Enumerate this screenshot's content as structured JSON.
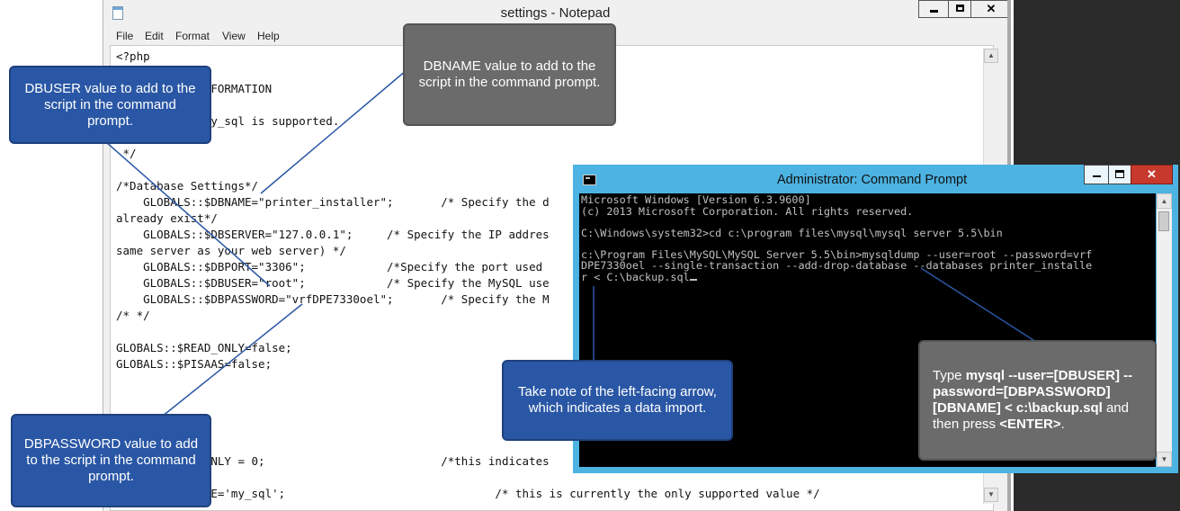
{
  "notepad": {
    "title": "settings - Notepad",
    "menu": [
      "File",
      "Edit",
      "Format",
      "View",
      "Help"
    ],
    "code_lines": [
      "<?php",
      "",
      "        ION INFORMATION",
      "",
      "        only my_sql is supported.",
      "",
      " */",
      "",
      "/*Database Settings*/",
      "    GLOBALS::$DBNAME=\"printer_installer\";       /* Specify the d",
      "already exist*/",
      "    GLOBALS::$DBSERVER=\"127.0.0.1\";     /* Specify the IP addres",
      "same server as your web server) */",
      "    GLOBALS::$DBPORT=\"3306\";            /*Specify the port used",
      "    GLOBALS::$DBUSER=\"root\";            /* Specify the MySQL use",
      "    GLOBALS::$DBPASSWORD=\"vrfDPE7330oel\";       /* Specify the M",
      "/* */",
      "",
      "GLOBALS::$READ_ONLY=false;",
      "GLOBALS::$PISAAS=false;",
      "",
      "",
      "",
      "",
      "",
      "            CONLY = 0;                          /*this indicates",
      "",
      "            YPE='my_sql';                               /* this is currently the only supported value */"
    ]
  },
  "cmd": {
    "title": "Administrator: Command Prompt",
    "lines": [
      "Microsoft Windows [Version 6.3.9600]",
      "(c) 2013 Microsoft Corporation. All rights reserved.",
      "",
      "C:\\Windows\\system32>cd c:\\program files\\mysql\\mysql server 5.5\\bin",
      "",
      "c:\\Program Files\\MySQL\\MySQL Server 5.5\\bin>mysqldump --user=root --password=vrf",
      "DPE7330oel --single-transaction --add-drop-database --databases printer_installe",
      "r < C:\\backup.sql"
    ]
  },
  "callouts": {
    "dbuser": "DBUSER value to add to the script in the command prompt.",
    "dbname": "DBNAME value to add to the script in the command prompt.",
    "dbpassword": "DBPASSWORD value to add to the script in the command prompt.",
    "arrow_note": "Take note of the left-facing arrow, which indicates a data import.",
    "type_instruction": {
      "prefix": "Type ",
      "bold1": "mysql --user=[DBUSER] --password=[DBPASSWORD] [DBNAME] < c:\\backup.sql",
      "middle": " and then press ",
      "bold2": "<ENTER>",
      "suffix": "."
    }
  },
  "colors": {
    "callout_blue": "#2a57a5",
    "callout_gray": "#6b6b6b",
    "cmd_frame": "#4cb3e2",
    "leader_line": "#2a57a5"
  }
}
